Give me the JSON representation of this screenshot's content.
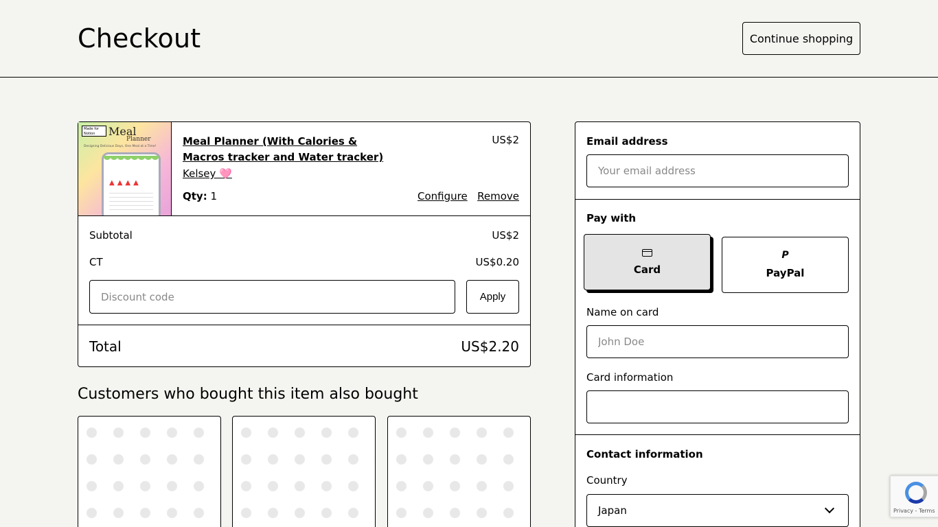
{
  "header": {
    "title": "Checkout",
    "continue_label": "Continue shopping"
  },
  "cart": {
    "item": {
      "thumb": {
        "badge": "Made for Notion",
        "heading": "Meal",
        "subheading": "Planner",
        "tagline": "Designing Delicious Days, One Meal at a Time!"
      },
      "title": "Meal Planner (With Calories & Macros tracker and Water tracker)",
      "price": "US$2",
      "seller": "Kelsey 🩷",
      "qty_label": "Qty:",
      "qty_value": "1",
      "configure_label": "Configure",
      "remove_label": "Remove"
    },
    "subtotal_label": "Subtotal",
    "subtotal_value": "US$2",
    "tax_label": "CT",
    "tax_value": "US$0.20",
    "discount_placeholder": "Discount code",
    "apply_label": "Apply",
    "total_label": "Total",
    "total_value": "US$2.20"
  },
  "recommendations": {
    "title": "Customers who bought this item also bought"
  },
  "payment": {
    "email_label": "Email address",
    "email_placeholder": "Your email address",
    "pay_with_label": "Pay with",
    "methods": [
      {
        "label": "Card",
        "icon": "credit-card-icon",
        "selected": true
      },
      {
        "label": "PayPal",
        "icon": "paypal-icon",
        "selected": false
      }
    ],
    "name_label": "Name on card",
    "name_placeholder": "John Doe",
    "card_info_label": "Card information",
    "contact_label": "Contact information",
    "country_label": "Country",
    "country_value": "Japan"
  },
  "recaptcha": {
    "links": "Privacy - Terms"
  }
}
